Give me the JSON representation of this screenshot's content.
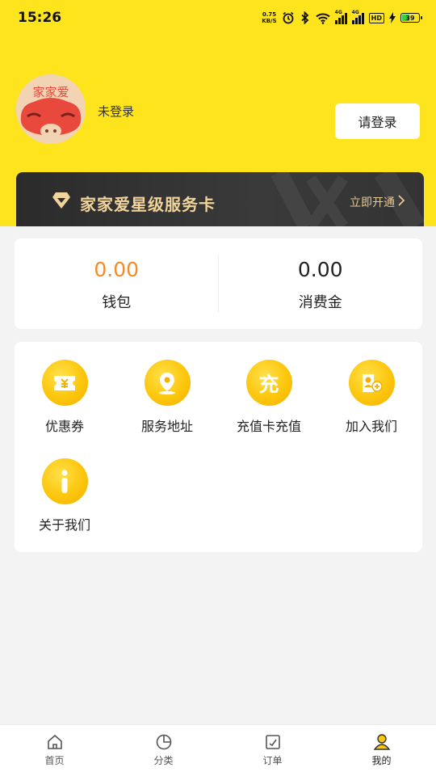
{
  "status_bar": {
    "time": "15:26",
    "net_speed_value": "0.75",
    "net_speed_unit": "KB/S",
    "signal_1": "4G",
    "signal_2": "4G",
    "hd_label": "HD",
    "battery": "39",
    "battery_level": 0.39,
    "battery_color": "#36d13c"
  },
  "profile": {
    "avatar_brand": "家家爱",
    "login_status": "未登录",
    "login_button": "请登录"
  },
  "vip_banner": {
    "title": "家家爱星级服务卡",
    "action": "立即开通",
    "title_color": "#f1d49c"
  },
  "balance": {
    "wallet_value": "0.00",
    "wallet_label": "钱包",
    "consume_value": "0.00",
    "consume_label": "消费金",
    "accent_color": "#f28c26"
  },
  "services": {
    "items": [
      {
        "label": "优惠券",
        "icon": "coupon-icon"
      },
      {
        "label": "服务地址",
        "icon": "location-icon"
      },
      {
        "label": "充值卡充值",
        "icon": "recharge-icon",
        "glyph": "充"
      },
      {
        "label": "加入我们",
        "icon": "join-us-icon"
      },
      {
        "label": "关于我们",
        "icon": "info-icon"
      }
    ]
  },
  "bottom_nav": {
    "items": [
      {
        "label": "首页",
        "icon": "home-icon"
      },
      {
        "label": "分类",
        "icon": "category-icon"
      },
      {
        "label": "订单",
        "icon": "order-icon"
      },
      {
        "label": "我的",
        "icon": "profile-icon",
        "active": true
      }
    ]
  },
  "colors": {
    "header_yellow": "#fde41c",
    "icon_yellow": "#fcc60c"
  }
}
